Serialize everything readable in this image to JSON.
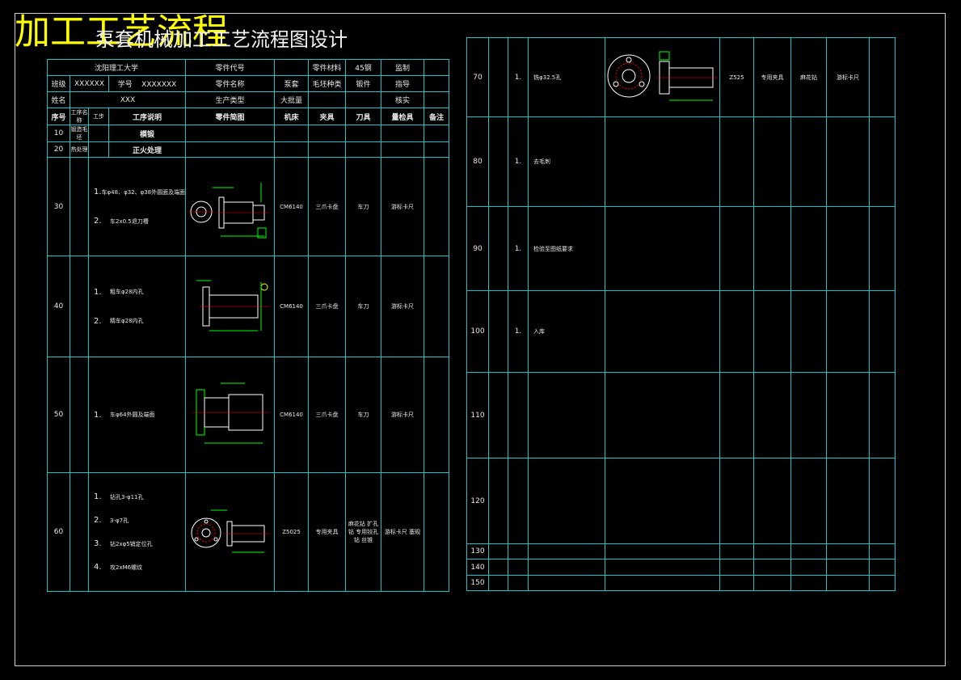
{
  "titles": {
    "main": "加工工艺流程",
    "sub": "泵套机械加工工艺流程图设计"
  },
  "colors": {
    "grid": "#19c3c3",
    "title": "#ffff00",
    "drawing": "#00ff00",
    "centerline": "#ff0000"
  },
  "left_header": {
    "school": "沈阳理工大学",
    "part_code_label": "零件代号",
    "material_label": "零件材料",
    "material_value": "45钢",
    "supervisor_label": "监制",
    "class_label": "班级",
    "class_value": "XXXXXX",
    "student_no_label": "学号",
    "student_no_value": "XXXXXXX",
    "part_name_label": "零件名称",
    "part_name_value": "泵套",
    "blank_type_label": "毛坯种类",
    "blank_type_value": "锻件",
    "guide_label": "指导",
    "name_label": "姓名",
    "name_value": "XXX",
    "production_label": "生产类型",
    "production_value": "大批量",
    "check_label": "核实"
  },
  "columns": {
    "seq": "序号",
    "op_name": "工序名称",
    "step_no": "工步",
    "op_desc": "工序说明",
    "sketch": "零件简图",
    "machine": "机床",
    "fixture": "夹具",
    "tool": "刀具",
    "gauge": "量检具",
    "note": "备注"
  },
  "left_ops": [
    {
      "seq": "10",
      "name": "锻造毛坯",
      "desc": "模锻"
    },
    {
      "seq": "20",
      "name": "热处理",
      "desc": "正火处理"
    },
    {
      "seq": "30",
      "steps": [
        {
          "n": "1.",
          "t": "车φ48、φ32、φ38外圆面及端面"
        },
        {
          "n": "2.",
          "t": "车2x0.5退刀槽"
        }
      ],
      "machine": "CM6140",
      "fixture": "三爪卡盘",
      "tool": "车刀",
      "gauge": "游标卡尺"
    },
    {
      "seq": "40",
      "steps": [
        {
          "n": "1.",
          "t": "粗车φ28内孔"
        },
        {
          "n": "2.",
          "t": "精车φ28内孔"
        }
      ],
      "machine": "CM6140",
      "fixture": "三爪卡盘",
      "tool": "车刀",
      "gauge": "游标卡尺"
    },
    {
      "seq": "50",
      "steps": [
        {
          "n": "1.",
          "t": "车φ64外圆及端面"
        }
      ],
      "machine": "CM6140",
      "fixture": "三爪卡盘",
      "tool": "车刀",
      "gauge": "游标卡尺"
    },
    {
      "seq": "60",
      "steps": [
        {
          "n": "1.",
          "t": "钻孔3-φ11孔"
        },
        {
          "n": "2.",
          "t": "3-φ7孔"
        },
        {
          "n": "3.",
          "t": "钻2xφ5销定位孔"
        },
        {
          "n": "4.",
          "t": "攻2xM6螺纹"
        }
      ],
      "machine": "Z5025",
      "fixture": "专用夹具",
      "tool": "麻花钻 扩孔钻 专用铰孔钻 丝锥",
      "gauge": "游标卡尺 塞规"
    }
  ],
  "right_ops": [
    {
      "seq": "70",
      "step": "1.",
      "desc": "铣φ32.5孔",
      "machine": "Z525",
      "fixture": "专用夹具",
      "tool": "麻花钻",
      "gauge": "游标卡尺"
    },
    {
      "seq": "80",
      "step": "1.",
      "desc": "去毛刺"
    },
    {
      "seq": "90",
      "step": "1.",
      "desc": "检验至图纸要求"
    },
    {
      "seq": "100",
      "step": "1.",
      "desc": "入库"
    },
    {
      "seq": "110"
    },
    {
      "seq": "120"
    },
    {
      "seq": "130"
    },
    {
      "seq": "140"
    },
    {
      "seq": "150"
    }
  ]
}
